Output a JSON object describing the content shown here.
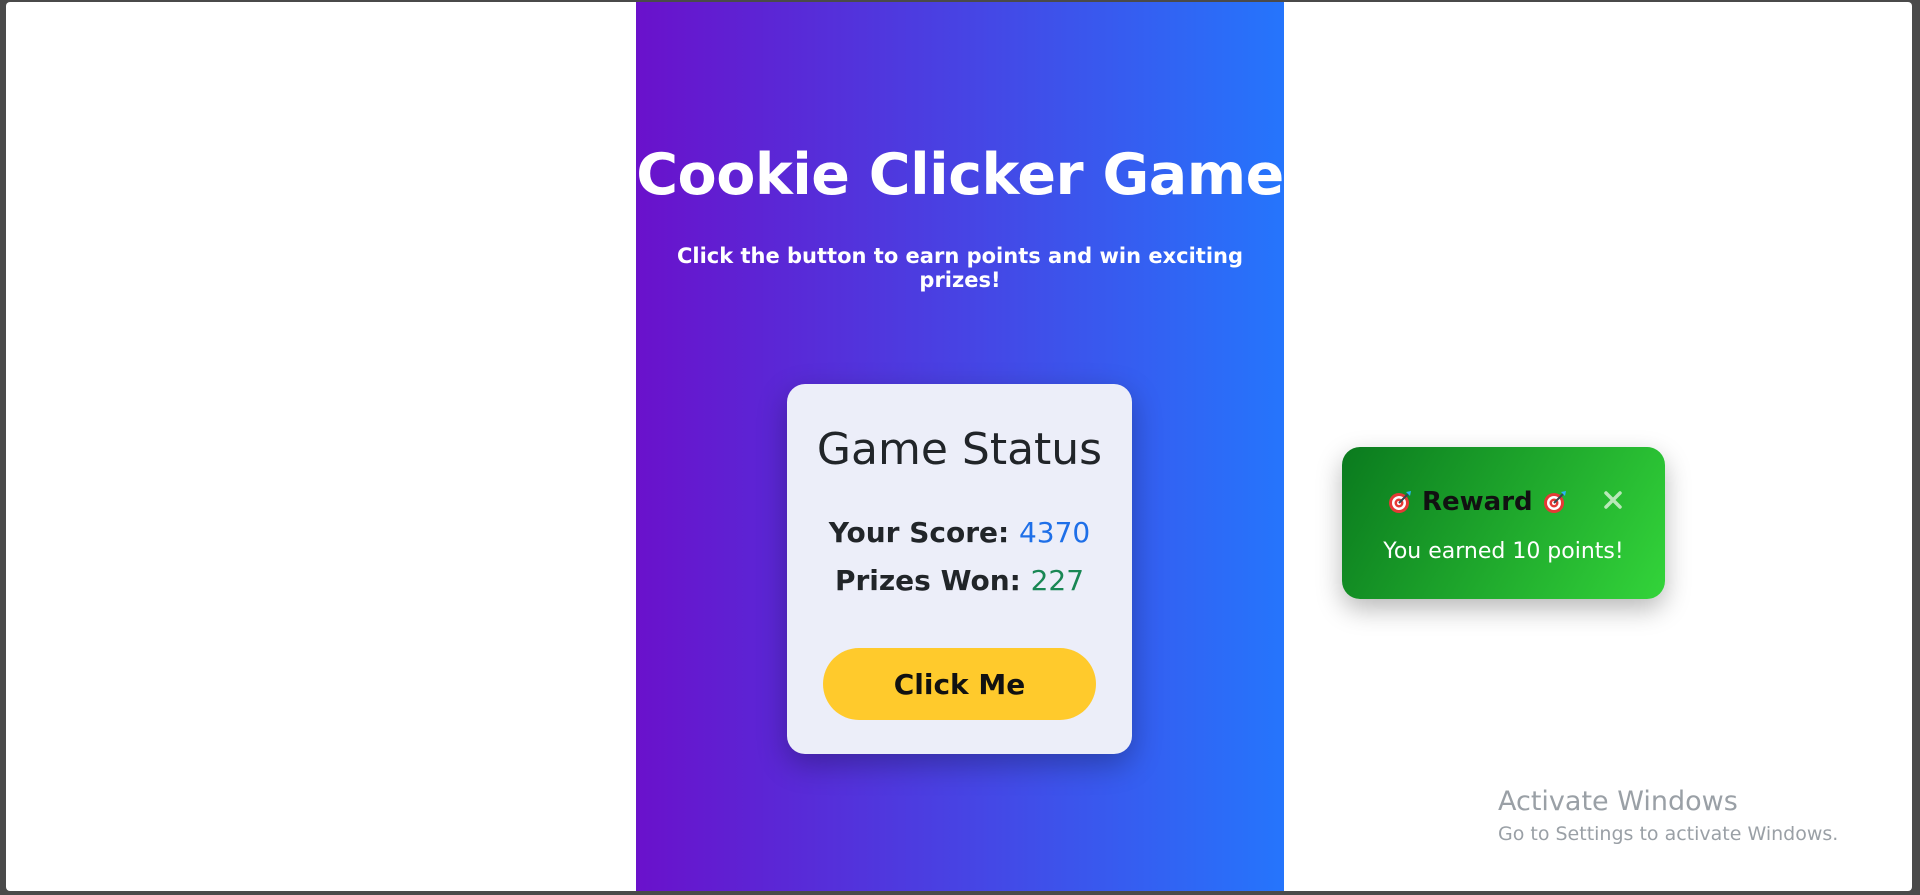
{
  "game": {
    "title": "Cookie Clicker Game",
    "subtitle": "Click the button to earn points and win exciting prizes!"
  },
  "status": {
    "heading": "Game Status",
    "score_label": "Your Score:",
    "score_value": "4370",
    "prizes_label": "Prizes Won:",
    "prizes_value": "227",
    "button_label": "Click Me"
  },
  "toast": {
    "title": "Reward",
    "message": "You earned 10 points!",
    "icon": "target-icon",
    "close_icon": "close-icon"
  },
  "watermark": {
    "title": "Activate Windows",
    "subtitle": "Go to Settings to activate Windows."
  },
  "colors": {
    "gradient_start": "#6a11cb",
    "gradient_end": "#2575fc",
    "card_bg": "#eceef9",
    "button": "#ffca2c",
    "score": "#1e6fe8",
    "prizes": "#198754",
    "toast_start": "#0a7a1e",
    "toast_end": "#33d43a"
  }
}
